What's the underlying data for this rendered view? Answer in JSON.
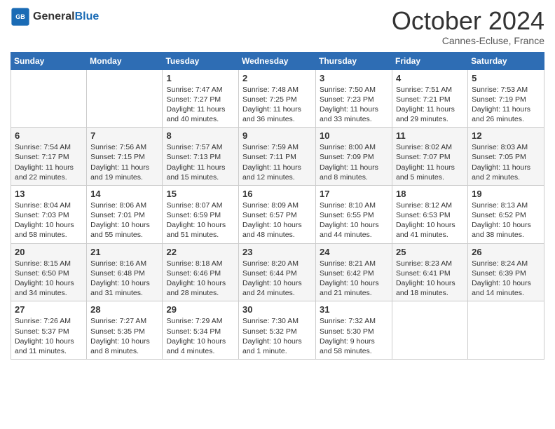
{
  "header": {
    "logo_line1": "General",
    "logo_line2": "Blue",
    "month": "October 2024",
    "location": "Cannes-Ecluse, France"
  },
  "weekdays": [
    "Sunday",
    "Monday",
    "Tuesday",
    "Wednesday",
    "Thursday",
    "Friday",
    "Saturday"
  ],
  "weeks": [
    [
      {
        "day": "",
        "content": ""
      },
      {
        "day": "",
        "content": ""
      },
      {
        "day": "1",
        "content": "Sunrise: 7:47 AM\nSunset: 7:27 PM\nDaylight: 11 hours and 40 minutes."
      },
      {
        "day": "2",
        "content": "Sunrise: 7:48 AM\nSunset: 7:25 PM\nDaylight: 11 hours and 36 minutes."
      },
      {
        "day": "3",
        "content": "Sunrise: 7:50 AM\nSunset: 7:23 PM\nDaylight: 11 hours and 33 minutes."
      },
      {
        "day": "4",
        "content": "Sunrise: 7:51 AM\nSunset: 7:21 PM\nDaylight: 11 hours and 29 minutes."
      },
      {
        "day": "5",
        "content": "Sunrise: 7:53 AM\nSunset: 7:19 PM\nDaylight: 11 hours and 26 minutes."
      }
    ],
    [
      {
        "day": "6",
        "content": "Sunrise: 7:54 AM\nSunset: 7:17 PM\nDaylight: 11 hours and 22 minutes."
      },
      {
        "day": "7",
        "content": "Sunrise: 7:56 AM\nSunset: 7:15 PM\nDaylight: 11 hours and 19 minutes."
      },
      {
        "day": "8",
        "content": "Sunrise: 7:57 AM\nSunset: 7:13 PM\nDaylight: 11 hours and 15 minutes."
      },
      {
        "day": "9",
        "content": "Sunrise: 7:59 AM\nSunset: 7:11 PM\nDaylight: 11 hours and 12 minutes."
      },
      {
        "day": "10",
        "content": "Sunrise: 8:00 AM\nSunset: 7:09 PM\nDaylight: 11 hours and 8 minutes."
      },
      {
        "day": "11",
        "content": "Sunrise: 8:02 AM\nSunset: 7:07 PM\nDaylight: 11 hours and 5 minutes."
      },
      {
        "day": "12",
        "content": "Sunrise: 8:03 AM\nSunset: 7:05 PM\nDaylight: 11 hours and 2 minutes."
      }
    ],
    [
      {
        "day": "13",
        "content": "Sunrise: 8:04 AM\nSunset: 7:03 PM\nDaylight: 10 hours and 58 minutes."
      },
      {
        "day": "14",
        "content": "Sunrise: 8:06 AM\nSunset: 7:01 PM\nDaylight: 10 hours and 55 minutes."
      },
      {
        "day": "15",
        "content": "Sunrise: 8:07 AM\nSunset: 6:59 PM\nDaylight: 10 hours and 51 minutes."
      },
      {
        "day": "16",
        "content": "Sunrise: 8:09 AM\nSunset: 6:57 PM\nDaylight: 10 hours and 48 minutes."
      },
      {
        "day": "17",
        "content": "Sunrise: 8:10 AM\nSunset: 6:55 PM\nDaylight: 10 hours and 44 minutes."
      },
      {
        "day": "18",
        "content": "Sunrise: 8:12 AM\nSunset: 6:53 PM\nDaylight: 10 hours and 41 minutes."
      },
      {
        "day": "19",
        "content": "Sunrise: 8:13 AM\nSunset: 6:52 PM\nDaylight: 10 hours and 38 minutes."
      }
    ],
    [
      {
        "day": "20",
        "content": "Sunrise: 8:15 AM\nSunset: 6:50 PM\nDaylight: 10 hours and 34 minutes."
      },
      {
        "day": "21",
        "content": "Sunrise: 8:16 AM\nSunset: 6:48 PM\nDaylight: 10 hours and 31 minutes."
      },
      {
        "day": "22",
        "content": "Sunrise: 8:18 AM\nSunset: 6:46 PM\nDaylight: 10 hours and 28 minutes."
      },
      {
        "day": "23",
        "content": "Sunrise: 8:20 AM\nSunset: 6:44 PM\nDaylight: 10 hours and 24 minutes."
      },
      {
        "day": "24",
        "content": "Sunrise: 8:21 AM\nSunset: 6:42 PM\nDaylight: 10 hours and 21 minutes."
      },
      {
        "day": "25",
        "content": "Sunrise: 8:23 AM\nSunset: 6:41 PM\nDaylight: 10 hours and 18 minutes."
      },
      {
        "day": "26",
        "content": "Sunrise: 8:24 AM\nSunset: 6:39 PM\nDaylight: 10 hours and 14 minutes."
      }
    ],
    [
      {
        "day": "27",
        "content": "Sunrise: 7:26 AM\nSunset: 5:37 PM\nDaylight: 10 hours and 11 minutes."
      },
      {
        "day": "28",
        "content": "Sunrise: 7:27 AM\nSunset: 5:35 PM\nDaylight: 10 hours and 8 minutes."
      },
      {
        "day": "29",
        "content": "Sunrise: 7:29 AM\nSunset: 5:34 PM\nDaylight: 10 hours and 4 minutes."
      },
      {
        "day": "30",
        "content": "Sunrise: 7:30 AM\nSunset: 5:32 PM\nDaylight: 10 hours and 1 minute."
      },
      {
        "day": "31",
        "content": "Sunrise: 7:32 AM\nSunset: 5:30 PM\nDaylight: 9 hours and 58 minutes."
      },
      {
        "day": "",
        "content": ""
      },
      {
        "day": "",
        "content": ""
      }
    ]
  ]
}
